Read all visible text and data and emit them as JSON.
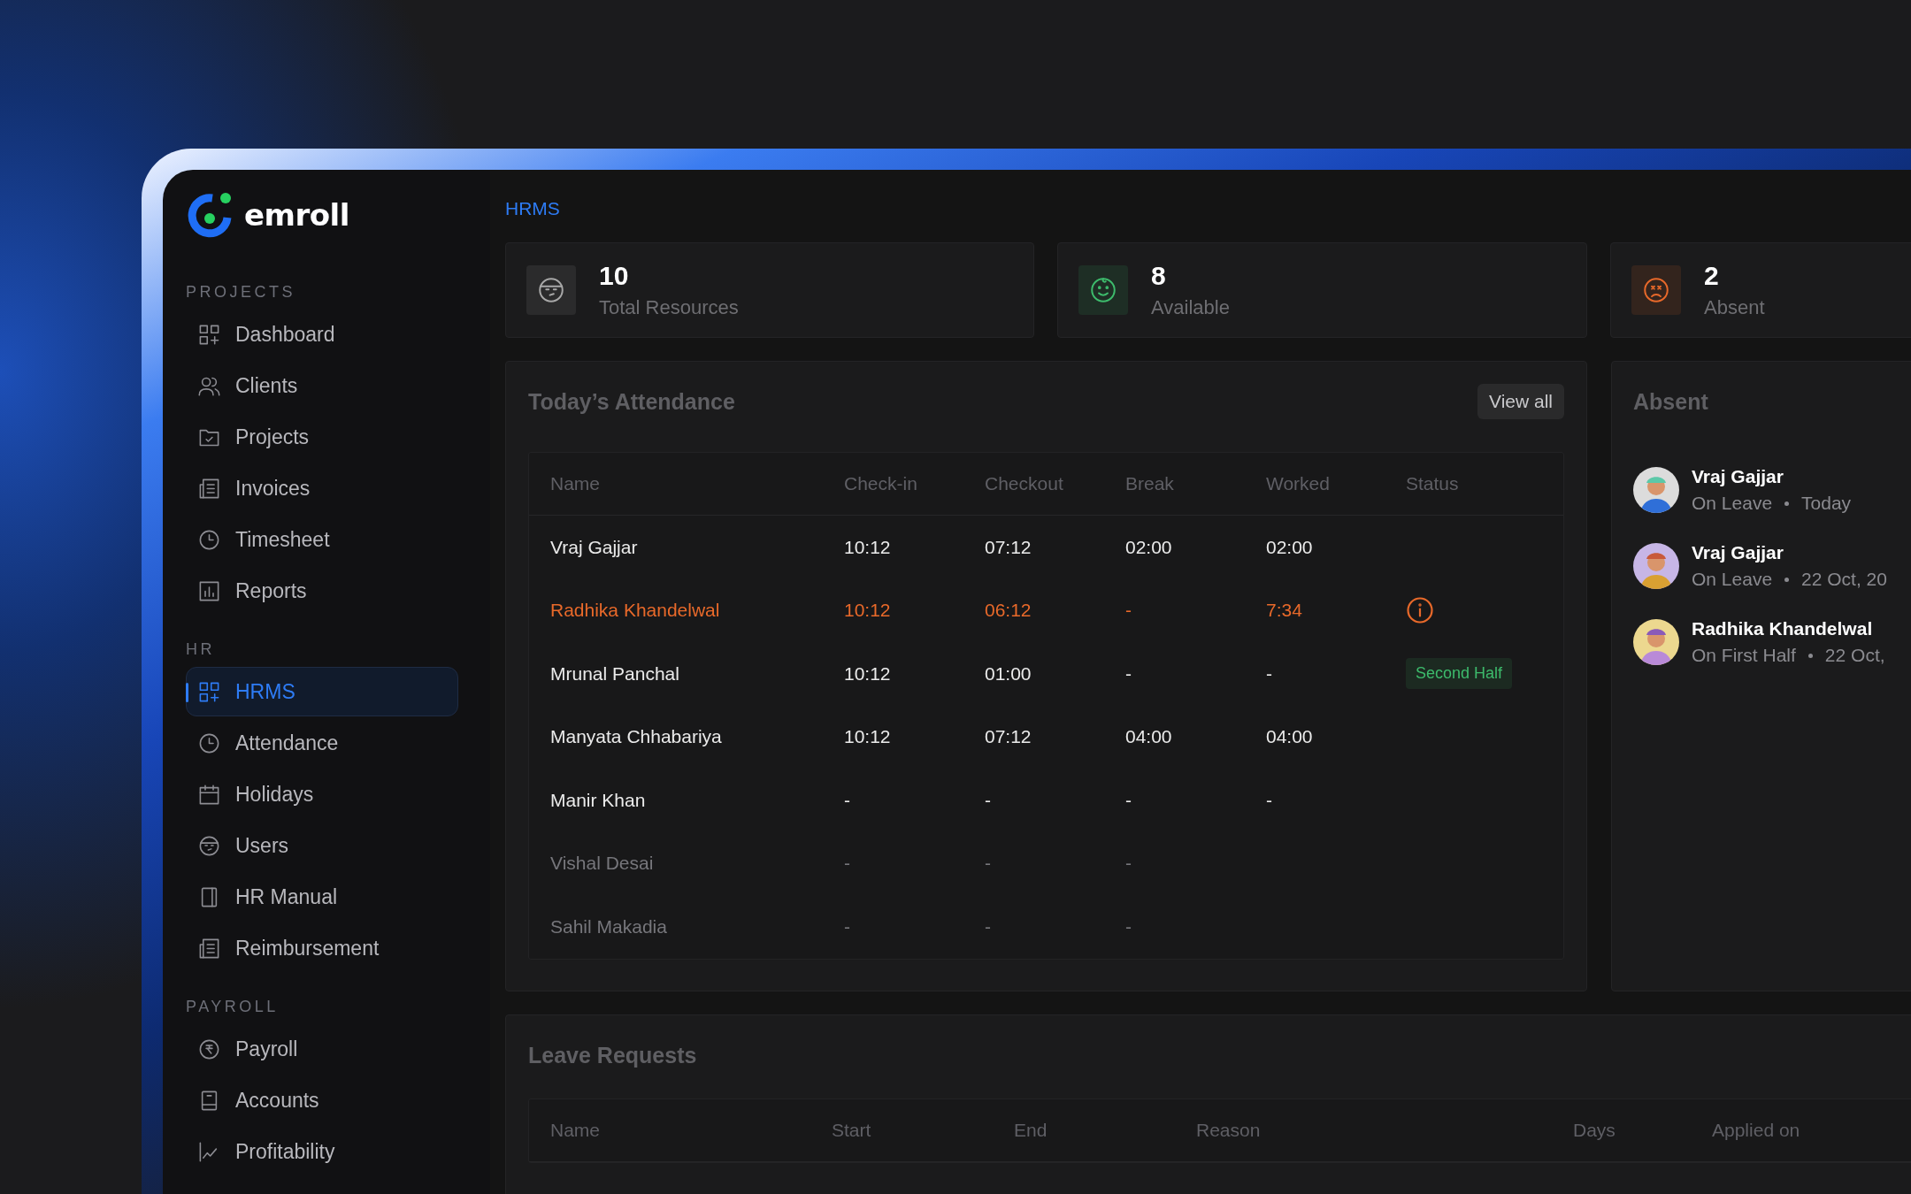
{
  "logo": {
    "text": "emroll"
  },
  "sidebar": {
    "sections": [
      {
        "title": "PROJECTS",
        "items": [
          {
            "label": "Dashboard",
            "selected": false
          },
          {
            "label": "Clients",
            "selected": false
          },
          {
            "label": "Projects",
            "selected": false
          },
          {
            "label": "Invoices",
            "selected": false
          },
          {
            "label": "Timesheet",
            "selected": false
          },
          {
            "label": "Reports",
            "selected": false
          }
        ]
      },
      {
        "title": "HR",
        "items": [
          {
            "label": "HRMS",
            "selected": true
          },
          {
            "label": "Attendance",
            "selected": false
          },
          {
            "label": "Holidays",
            "selected": false
          },
          {
            "label": "Users",
            "selected": false
          },
          {
            "label": "HR Manual",
            "selected": false
          },
          {
            "label": "Reimbursement",
            "selected": false
          }
        ]
      },
      {
        "title": "PAYROLL",
        "items": [
          {
            "label": "Payroll",
            "selected": false
          },
          {
            "label": "Accounts",
            "selected": false
          },
          {
            "label": "Profitability",
            "selected": false
          }
        ]
      }
    ]
  },
  "breadcrumb": "HRMS",
  "stats": [
    {
      "value": "10",
      "label": "Total Resources",
      "kind": "neutral",
      "color": "#a8a8a8"
    },
    {
      "value": "8",
      "label": "Available",
      "kind": "happy",
      "color": "#3dbb6c"
    },
    {
      "value": "2",
      "label": "Absent",
      "kind": "sad",
      "color": "#e8692a"
    }
  ],
  "attendance": {
    "title": "Today’s Attendance",
    "button": "View all",
    "columns": [
      "Name",
      "Check-in",
      "Checkout",
      "Break",
      "Worked",
      "Status"
    ],
    "rows": [
      {
        "kind": "normal",
        "name": "Vraj Gajjar",
        "check_in": "10:12",
        "checkout": "07:12",
        "break": "02:00",
        "worked": "02:00"
      },
      {
        "kind": "alert",
        "name": "Radhika Khandelwal",
        "check_in": "10:12",
        "checkout": "06:12",
        "break": "-",
        "worked": "7:34",
        "status": {
          "kind": "info-icon"
        }
      },
      {
        "kind": "normal",
        "name": "Mrunal Panchal",
        "check_in": "10:12",
        "checkout": "01:00",
        "break": "-",
        "worked": "-",
        "status": {
          "kind": "badge",
          "text": "Second Half"
        }
      },
      {
        "kind": "normal",
        "name": "Manyata Chhabariya",
        "check_in": "10:12",
        "checkout": "07:12",
        "break": "04:00",
        "worked": "04:00"
      },
      {
        "kind": "normal",
        "name": "Manir Khan",
        "check_in": "-",
        "checkout": "-",
        "break": "-",
        "worked": "-"
      },
      {
        "kind": "inactive",
        "name": "Vishal Desai",
        "check_in": "-",
        "checkout": "-",
        "break": "-"
      },
      {
        "kind": "inactive",
        "name": "Sahil Makadia",
        "check_in": "-",
        "checkout": "-",
        "break": "-"
      }
    ]
  },
  "absent": {
    "title": "Absent",
    "items": [
      {
        "name": "Vraj Gajjar",
        "status": "On Leave",
        "date": "Today",
        "color": "#dcdcdc"
      },
      {
        "name": "Vraj Gajjar",
        "status": "On Leave",
        "date": "22 Oct, 20",
        "color": "#c7b6e6"
      },
      {
        "name": "Radhika Khandelwal",
        "status": "On First Half",
        "date": "22 Oct,",
        "color": "#ecd88f"
      }
    ]
  },
  "leave_requests": {
    "title": "Leave Requests",
    "columns": [
      "Name",
      "Start",
      "End",
      "Reason",
      "Days",
      "Applied on"
    ]
  }
}
